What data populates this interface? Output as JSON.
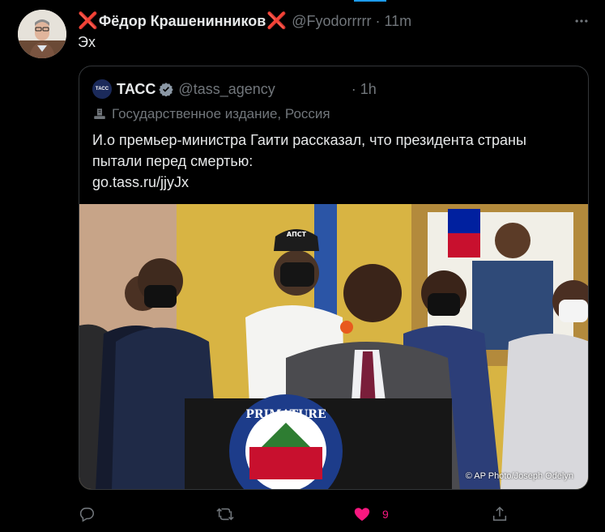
{
  "tweet": {
    "author_name": "Фёдор Крашенинников",
    "author_prefix_emoji": "❌",
    "author_suffix_emoji": "❌",
    "handle": "@Fyodorrrrr",
    "separator": "·",
    "time": "11m",
    "text": "Эх"
  },
  "quote": {
    "logo_text": "ТАСС",
    "name": "ТАСС",
    "handle": "@tass_agency",
    "separator": "·",
    "time": "1h",
    "label": "Государственное издание, Россия",
    "text_line1": "И.о премьер-министра Гаити рассказал, что президента страны",
    "text_line2": "пытали перед смертью:",
    "link": "go.tass.ru/jjyJx",
    "photo_credit": "© AP Photo/Joseph Odelyn",
    "podium_text": "PRIMATURE",
    "cap_text": "АПСТ"
  },
  "actions": {
    "like_count": "9"
  },
  "icons": {
    "reply": "reply-icon",
    "retweet": "retweet-icon",
    "like": "heart-icon",
    "share": "share-icon",
    "more": "more-icon",
    "verified": "verified-badge-icon",
    "label": "government-building-icon"
  },
  "colors": {
    "background": "#000000",
    "accent": "#1d9bf0",
    "like": "#f91880",
    "muted": "#71767b",
    "red_x": "#e0245e"
  }
}
